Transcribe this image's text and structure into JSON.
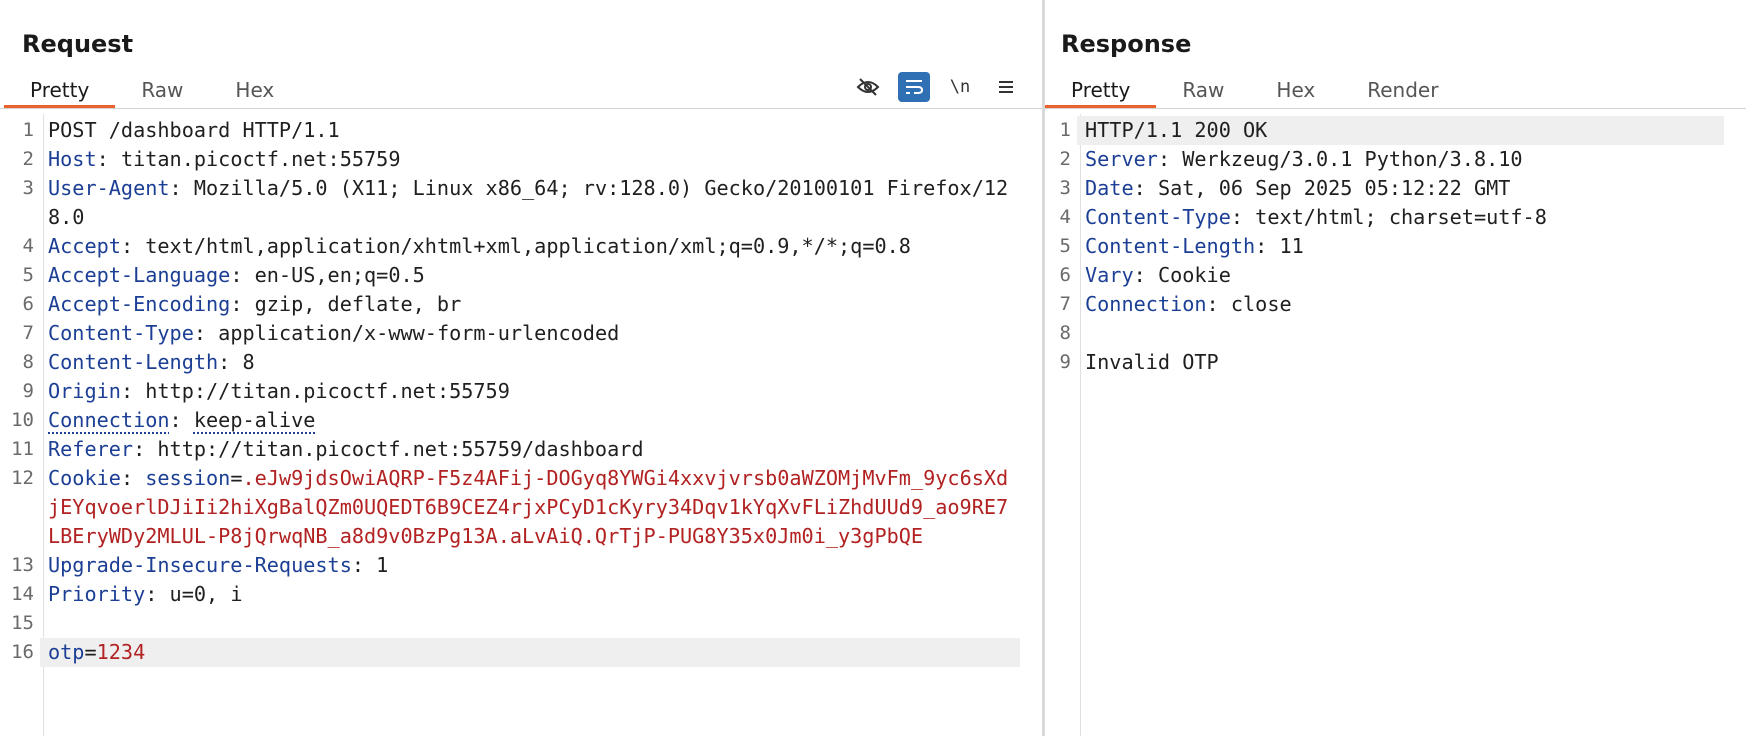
{
  "request": {
    "title": "Request",
    "tabs": [
      "Pretty",
      "Raw",
      "Hex"
    ],
    "toolbar_icons": [
      "eye-slash-icon",
      "wrap-lines-icon",
      "newline-icon",
      "menu-icon"
    ],
    "newline_glyph": "\\n",
    "lines": [
      {
        "n": "1",
        "k": "",
        "sep": "",
        "v": "POST /dashboard HTTP/1.1"
      },
      {
        "n": "2",
        "k": "Host",
        "sep": ": ",
        "v": "titan.picoctf.net:55759"
      },
      {
        "n": "3",
        "k": "User-Agent",
        "sep": ": ",
        "v": "Mozilla/5.0 (X11; Linux x86_64; rv:128.0) Gecko/20100101 Firefox/128.0"
      },
      {
        "n": "4",
        "k": "Accept",
        "sep": ": ",
        "v": "text/html,application/xhtml+xml,application/xml;q=0.9,*/*;q=0.8"
      },
      {
        "n": "5",
        "k": "Accept-Language",
        "sep": ": ",
        "v": "en-US,en;q=0.5"
      },
      {
        "n": "6",
        "k": "Accept-Encoding",
        "sep": ": ",
        "v": "gzip, deflate, br"
      },
      {
        "n": "7",
        "k": "Content-Type",
        "sep": ": ",
        "v": "application/x-www-form-urlencoded"
      },
      {
        "n": "8",
        "k": "Content-Length",
        "sep": ": ",
        "v": "8"
      },
      {
        "n": "9",
        "k": "Origin",
        "sep": ": ",
        "v": "http://titan.picoctf.net:55759"
      },
      {
        "n": "10",
        "k": "Connection",
        "sep": ": ",
        "v": "keep-alive"
      },
      {
        "n": "11",
        "k": "Referer",
        "sep": ": ",
        "v": "http://titan.picoctf.net:55759/dashboard"
      },
      {
        "n": "12",
        "k": "Cookie",
        "sep": ": ",
        "ck": "session",
        "csep": "=",
        "cv": ".eJw9jdsOwiAQRP-F5z4AFij-DOGyq8YWGi4xxvjvrsb0aWZOMjMvFm_9yc6sXdjEYqvoerlDJiIi2hiXgBalQZm0UQEDT6B9CEZ4rjxPCyD1cKyry34Dqv1kYqXvFLiZhdUUd9_ao9RE7LBEryWDy2MLUL-P8jQrwqNB_a8d9v0BzPg13A.aLvAiQ.QrTjP-PUG8Y35x0Jm0i_y3gPbQE"
      },
      {
        "n": "13",
        "k": "Upgrade-Insecure-Requests",
        "sep": ": ",
        "v": "1"
      },
      {
        "n": "14",
        "k": "Priority",
        "sep": ": ",
        "v": "u=0, i"
      },
      {
        "n": "15",
        "k": "",
        "sep": "",
        "v": ""
      },
      {
        "n": "16",
        "k": "otp",
        "sep": "=",
        "cv": "1234"
      }
    ]
  },
  "response": {
    "title": "Response",
    "tabs": [
      "Pretty",
      "Raw",
      "Hex",
      "Render"
    ],
    "lines": [
      {
        "n": "1",
        "k": "",
        "sep": "",
        "v": "HTTP/1.1 200 OK"
      },
      {
        "n": "2",
        "k": "Server",
        "sep": ": ",
        "v": "Werkzeug/3.0.1 Python/3.8.10"
      },
      {
        "n": "3",
        "k": "Date",
        "sep": ": ",
        "v": "Sat, 06 Sep 2025 05:12:22 GMT"
      },
      {
        "n": "4",
        "k": "Content-Type",
        "sep": ": ",
        "v": "text/html; charset=utf-8"
      },
      {
        "n": "5",
        "k": "Content-Length",
        "sep": ": ",
        "v": "11"
      },
      {
        "n": "6",
        "k": "Vary",
        "sep": ": ",
        "v": "Cookie"
      },
      {
        "n": "7",
        "k": "Connection",
        "sep": ": ",
        "v": "close"
      },
      {
        "n": "8",
        "k": "",
        "sep": "",
        "v": ""
      },
      {
        "n": "9",
        "k": "",
        "sep": "",
        "v": "Invalid OTP"
      }
    ]
  }
}
